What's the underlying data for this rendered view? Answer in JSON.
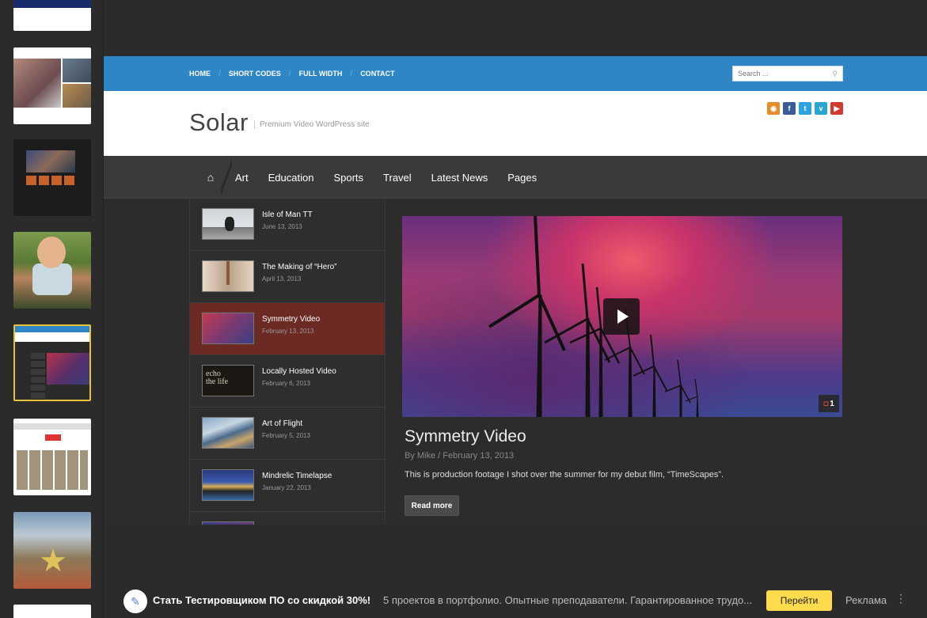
{
  "site": {
    "topnav": [
      "HOME",
      "SHORT CODES",
      "FULL WIDTH",
      "CONTACT"
    ],
    "search_placeholder": "Search ...",
    "logo": "Solar",
    "tagline": "Premium Video WordPress site",
    "social": [
      {
        "icon": "rss-icon",
        "glyph": "◉",
        "color": "#e98b2a"
      },
      {
        "icon": "facebook-icon",
        "glyph": "f",
        "color": "#3b5a9a"
      },
      {
        "icon": "twitter-icon",
        "glyph": "t",
        "color": "#2aa3e0"
      },
      {
        "icon": "vimeo-icon",
        "glyph": "v",
        "color": "#29a6d4"
      },
      {
        "icon": "youtube-icon",
        "glyph": "▶",
        "color": "#d33a2e"
      }
    ],
    "mainnav": [
      "Art",
      "Education",
      "Sports",
      "Travel",
      "Latest News",
      "Pages"
    ],
    "videos": [
      {
        "title": "Isle of Man TT",
        "date": "June 13, 2013",
        "thumb": "p1"
      },
      {
        "title": "The Making of “Hero”",
        "date": "April 13, 2013",
        "thumb": "p2"
      },
      {
        "title": "Symmetry Video",
        "date": "February 13, 2013",
        "thumb": "p3",
        "active": true
      },
      {
        "title": "Locally Hosted Video",
        "date": "February 6, 2013",
        "thumb": "p4",
        "thumb_text": [
          "echo",
          "the life"
        ]
      },
      {
        "title": "Art of Flight",
        "date": "February 5, 2013",
        "thumb": "p5"
      },
      {
        "title": "Mindrelic Timelapse",
        "date": "January 22, 2013",
        "thumb": "p6"
      },
      {
        "title": "",
        "date": "",
        "thumb": "p7"
      }
    ],
    "post": {
      "title": "Symmetry Video",
      "meta": "By Mike / February 13, 2013",
      "excerpt": "This is production footage I shot over the summer for my debut film, “TimeScapes”.",
      "read_more": "Read more",
      "comment_count": "1"
    }
  },
  "ad": {
    "title": "Стать Тестировщиком ПО со скидкой 30%!",
    "description": "5 проектов в портфолио. Опытные преподаватели. Гарантированное трудо...",
    "button": "Перейти",
    "label": "Реклама",
    "menu": "⋮"
  },
  "colors": {
    "topbar": "#2f86c5",
    "active_item": "#6b2a24",
    "ad_button": "#ffdb4d",
    "selected_thumb_border": "#e8c23a"
  }
}
